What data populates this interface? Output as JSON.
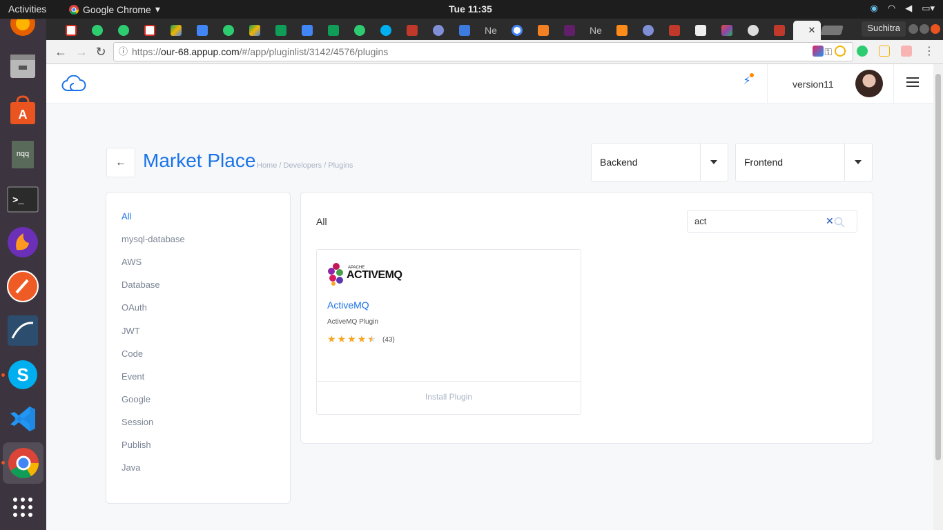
{
  "topbar": {
    "activities": "Activities",
    "app_name": "Google Chrome",
    "clock": "Tue 11:35"
  },
  "dock": {
    "items": [
      "firefox",
      "files",
      "software-center",
      "nqq",
      "terminal",
      "firefox-dev",
      "postman",
      "mysql-workbench",
      "skype",
      "vscode",
      "chrome",
      "app-grid"
    ],
    "nqq_label": "nqq"
  },
  "browser": {
    "profile": "Suchitra",
    "url_scheme": "https://",
    "url_host": "our-68.appup.com",
    "url_path": "/#/app/pluginlist/3142/4576/plugins",
    "tabs": [
      "gmail",
      "app",
      "app",
      "gmail",
      "drive",
      "docs",
      "app",
      "drive",
      "sheets",
      "docs",
      "sheets",
      "app",
      "skype",
      "amo",
      "app",
      "app",
      "Ne",
      "google",
      "stackoverflow",
      "slack",
      "Ne",
      "app",
      "app",
      "amo",
      "file",
      "app",
      "settings",
      "amo",
      "active"
    ],
    "tab_text_ne": "Ne"
  },
  "header": {
    "version": "version11"
  },
  "page": {
    "title": "Market Place",
    "breadcrumb": "Home  /  Developers  /  Plugins",
    "backend_label": "Backend",
    "frontend_label": "Frontend"
  },
  "categories": [
    "All",
    "mysql-database",
    "AWS",
    "Database",
    "OAuth",
    "JWT",
    "Code",
    "Event",
    "Google",
    "Session",
    "Publish",
    "Java"
  ],
  "main": {
    "heading": "All",
    "search_value": "act",
    "plugin": {
      "logo_text_small": "APACHE",
      "logo_text": "ACTIVEMQ",
      "name": "ActiveMQ",
      "description": "ActiveMQ Plugin",
      "rating": 4.5,
      "count": "(43)",
      "install_label": "Install Plugin"
    }
  },
  "colors": {
    "accent": "#1a73e8",
    "star": "#f5a623",
    "dock": "#3c3540"
  }
}
